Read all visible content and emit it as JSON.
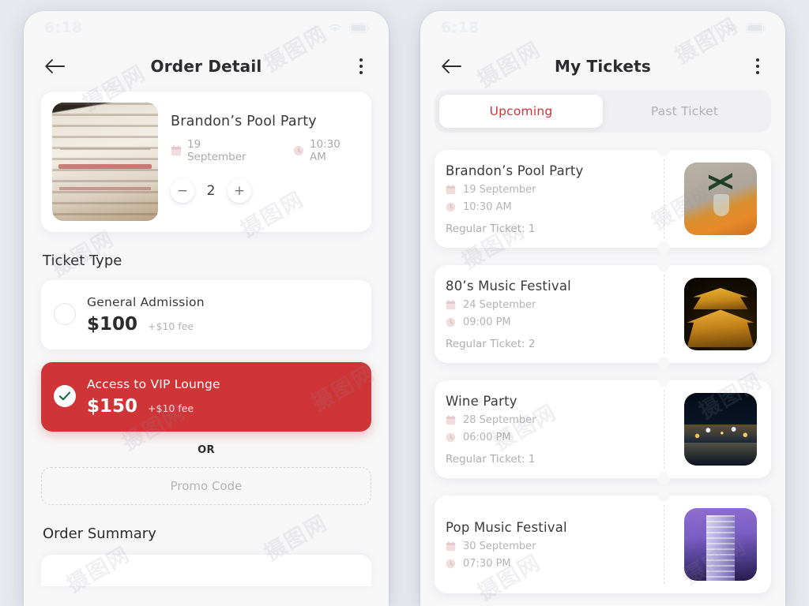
{
  "theme": {
    "accent": "#cf3437",
    "bg": "#e7e9ef",
    "check_green": "#1f6b4a"
  },
  "screens": [
    {
      "status": {
        "time": "6:18",
        "icons": [
          "signal-icon",
          "wifi-icon",
          "battery-icon"
        ]
      },
      "appbar": {
        "back": "back-arrow-icon",
        "title": "Order Detail",
        "menu": "kebab-menu-icon"
      },
      "event": {
        "title": "Brandon’s Pool Party",
        "date": "19 September",
        "time": "10:30 AM",
        "date_icon": "calendar-icon",
        "time_icon": "clock-icon",
        "thumb": "library-photo",
        "stepper": {
          "minus": "−",
          "value": "2",
          "plus": "+"
        }
      },
      "ticket_type": {
        "heading": "Ticket Type",
        "options": [
          {
            "name": "General Admission",
            "price": "$100",
            "fee": "+$10 fee",
            "selected": false
          },
          {
            "name": "Access to VIP Lounge",
            "price": "$150",
            "fee": "+$10 fee",
            "selected": true
          }
        ]
      },
      "or_label": "OR",
      "promo": {
        "placeholder": "Promo Code",
        "value": ""
      },
      "summary_heading": "Order Summary"
    },
    {
      "status": {
        "time": "6:18",
        "icons": [
          "signal-icon",
          "wifi-icon",
          "battery-icon"
        ]
      },
      "appbar": {
        "back": "back-arrow-icon",
        "title": "My Tickets",
        "menu": "kebab-menu-icon"
      },
      "tabs": [
        {
          "label": "Upcoming",
          "active": true
        },
        {
          "label": "Past Ticket",
          "active": false
        }
      ],
      "tickets": [
        {
          "title": "Brandon’s Pool Party",
          "date": "19 September",
          "time": "10:30 AM",
          "qty": "Regular Ticket: 1",
          "thumb": "plant-photo"
        },
        {
          "title": "80’s Music Festival",
          "date": "24 September",
          "time": "09:00 PM",
          "qty": "Regular Ticket: 2",
          "thumb": "temple-photo"
        },
        {
          "title": "Wine Party",
          "date": "28 September",
          "time": "06:00 PM",
          "qty": "Regular Ticket: 1",
          "thumb": "city-photo"
        },
        {
          "title": "Pop Music Festival",
          "date": "30 September",
          "time": "07:30 PM",
          "qty": "",
          "thumb": "tower-photo"
        }
      ]
    }
  ]
}
